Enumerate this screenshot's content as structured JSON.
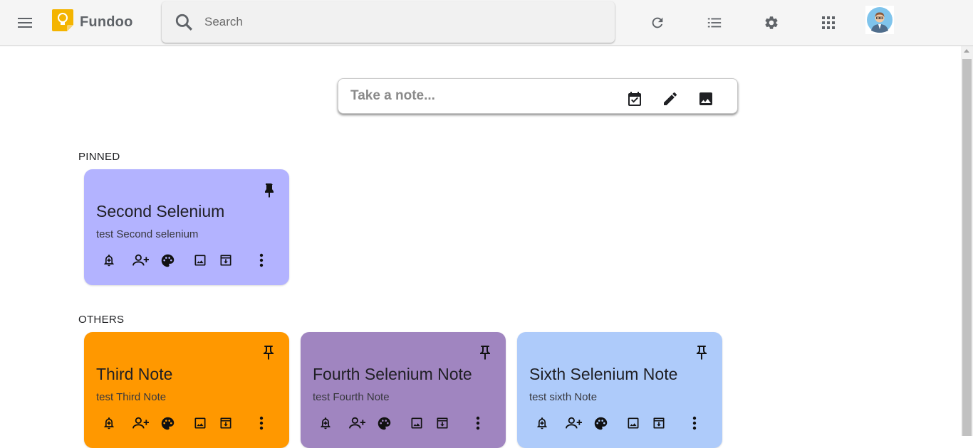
{
  "app": {
    "title": "Fundoo"
  },
  "icons": {
    "menu": "menu-icon",
    "logo": "lightbulb-icon",
    "search": "search-icon",
    "refresh": "refresh-icon",
    "list_view": "list-view-icon",
    "settings": "gear-icon",
    "apps": "apps-grid-icon",
    "avatar": "avatar",
    "checklist": "checkbox-calendar-icon",
    "draw": "pencil-icon",
    "image": "image-icon",
    "pin": "pin-icon",
    "reminder": "bell-plus-icon",
    "collaborator": "person-add-icon",
    "color": "palette-icon",
    "archive": "archive-icon",
    "more": "more-vert-icon"
  },
  "search": {
    "placeholder": "Search",
    "value": ""
  },
  "take_note": {
    "placeholder": "Take a note..."
  },
  "sections": {
    "pinned": "PINNED",
    "others": "OTHERS"
  },
  "notes": [
    {
      "title": "Second Selenium",
      "body": "test Second selenium",
      "color": "#b3b3ff",
      "pinned": true
    },
    {
      "title": "Third Note",
      "body": "test Third Note",
      "color": "#ff9800",
      "pinned": false
    },
    {
      "title": "Fourth Selenium Note",
      "body": "test Fourth Note",
      "color": "#a085c0",
      "pinned": false
    },
    {
      "title": "Sixth Selenium Note",
      "body": "test sixth Note",
      "color": "#aecbfa",
      "pinned": false
    }
  ]
}
